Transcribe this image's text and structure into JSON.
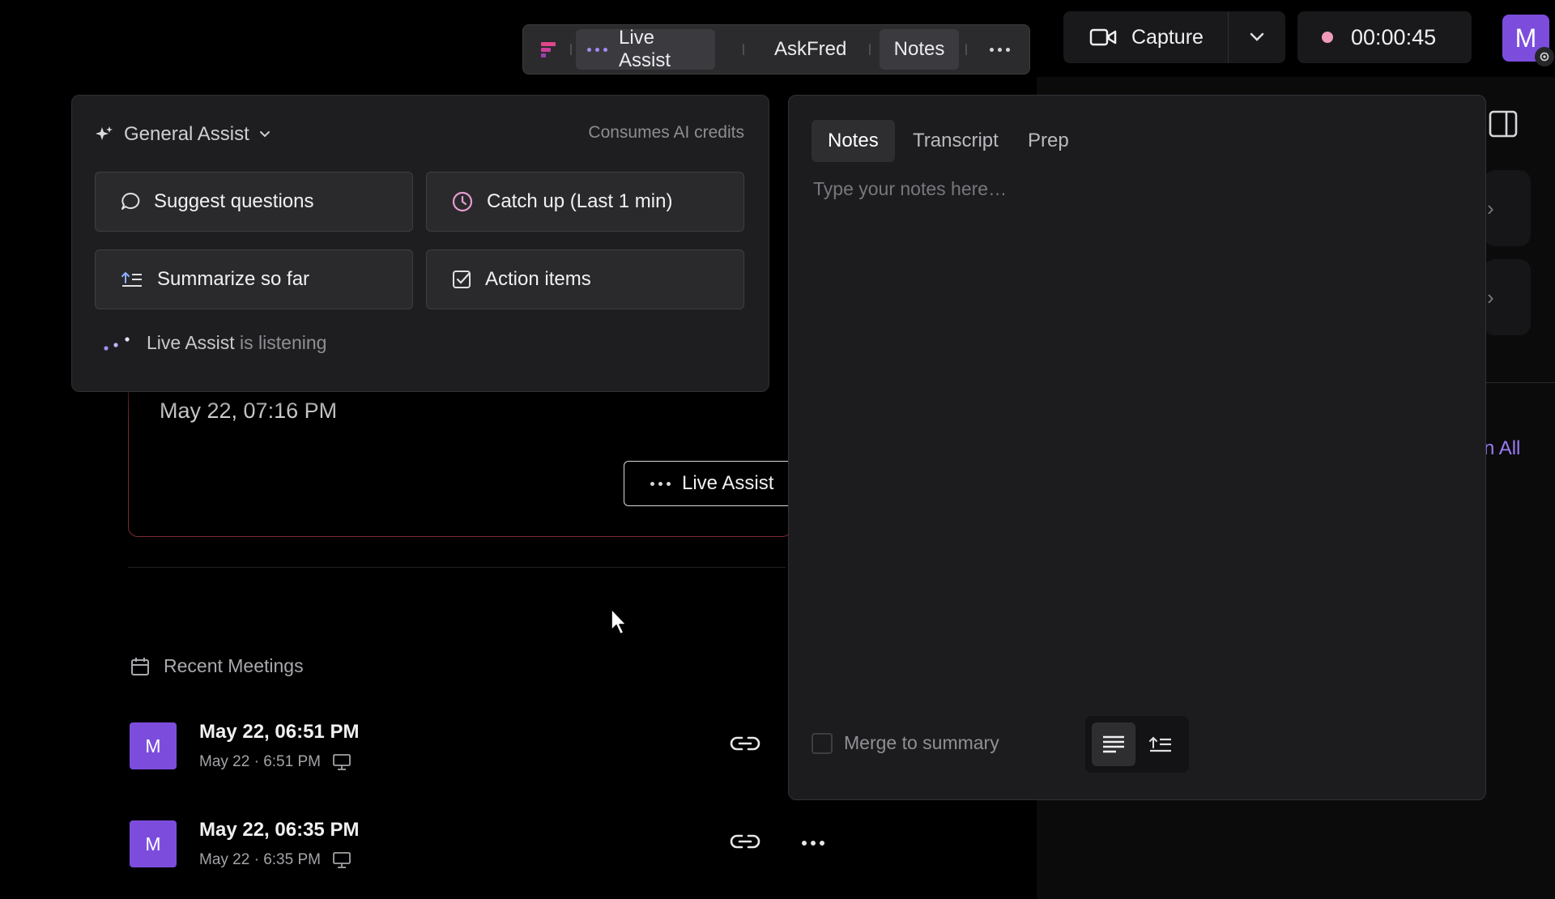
{
  "toolbar": {
    "live_assist": "Live Assist",
    "askfred": "AskFred",
    "notes": "Notes",
    "capture": "Capture",
    "timer": "00:00:45",
    "avatar_initial": "M"
  },
  "assist": {
    "mode": "General Assist",
    "credits": "Consumes AI credits",
    "buttons": [
      "Suggest questions",
      "Catch up (Last 1 min)",
      "Summarize so far",
      "Action items"
    ],
    "status_name": "Live Assist",
    "status_text": "is listening"
  },
  "card": {
    "date": "May 22, 07:16 PM",
    "button": "Live Assist"
  },
  "recent": {
    "heading": "Recent Meetings",
    "meetings": [
      {
        "initial": "M",
        "title": "May 22, 06:51 PM",
        "subtitle": "May 22 · 6:51 PM"
      },
      {
        "initial": "M",
        "title": "May 22, 06:35 PM",
        "subtitle": "May 22 · 6:35 PM"
      }
    ]
  },
  "notes_panel": {
    "tabs": [
      "Notes",
      "Transcript",
      "Prep"
    ],
    "placeholder": "Type your notes here…",
    "merge": "Merge to summary"
  },
  "right": {
    "link": "n All"
  },
  "colors": {
    "accent": "#7c4ddc",
    "recording": "#f09bb8",
    "card_border": "#7c2b31"
  }
}
